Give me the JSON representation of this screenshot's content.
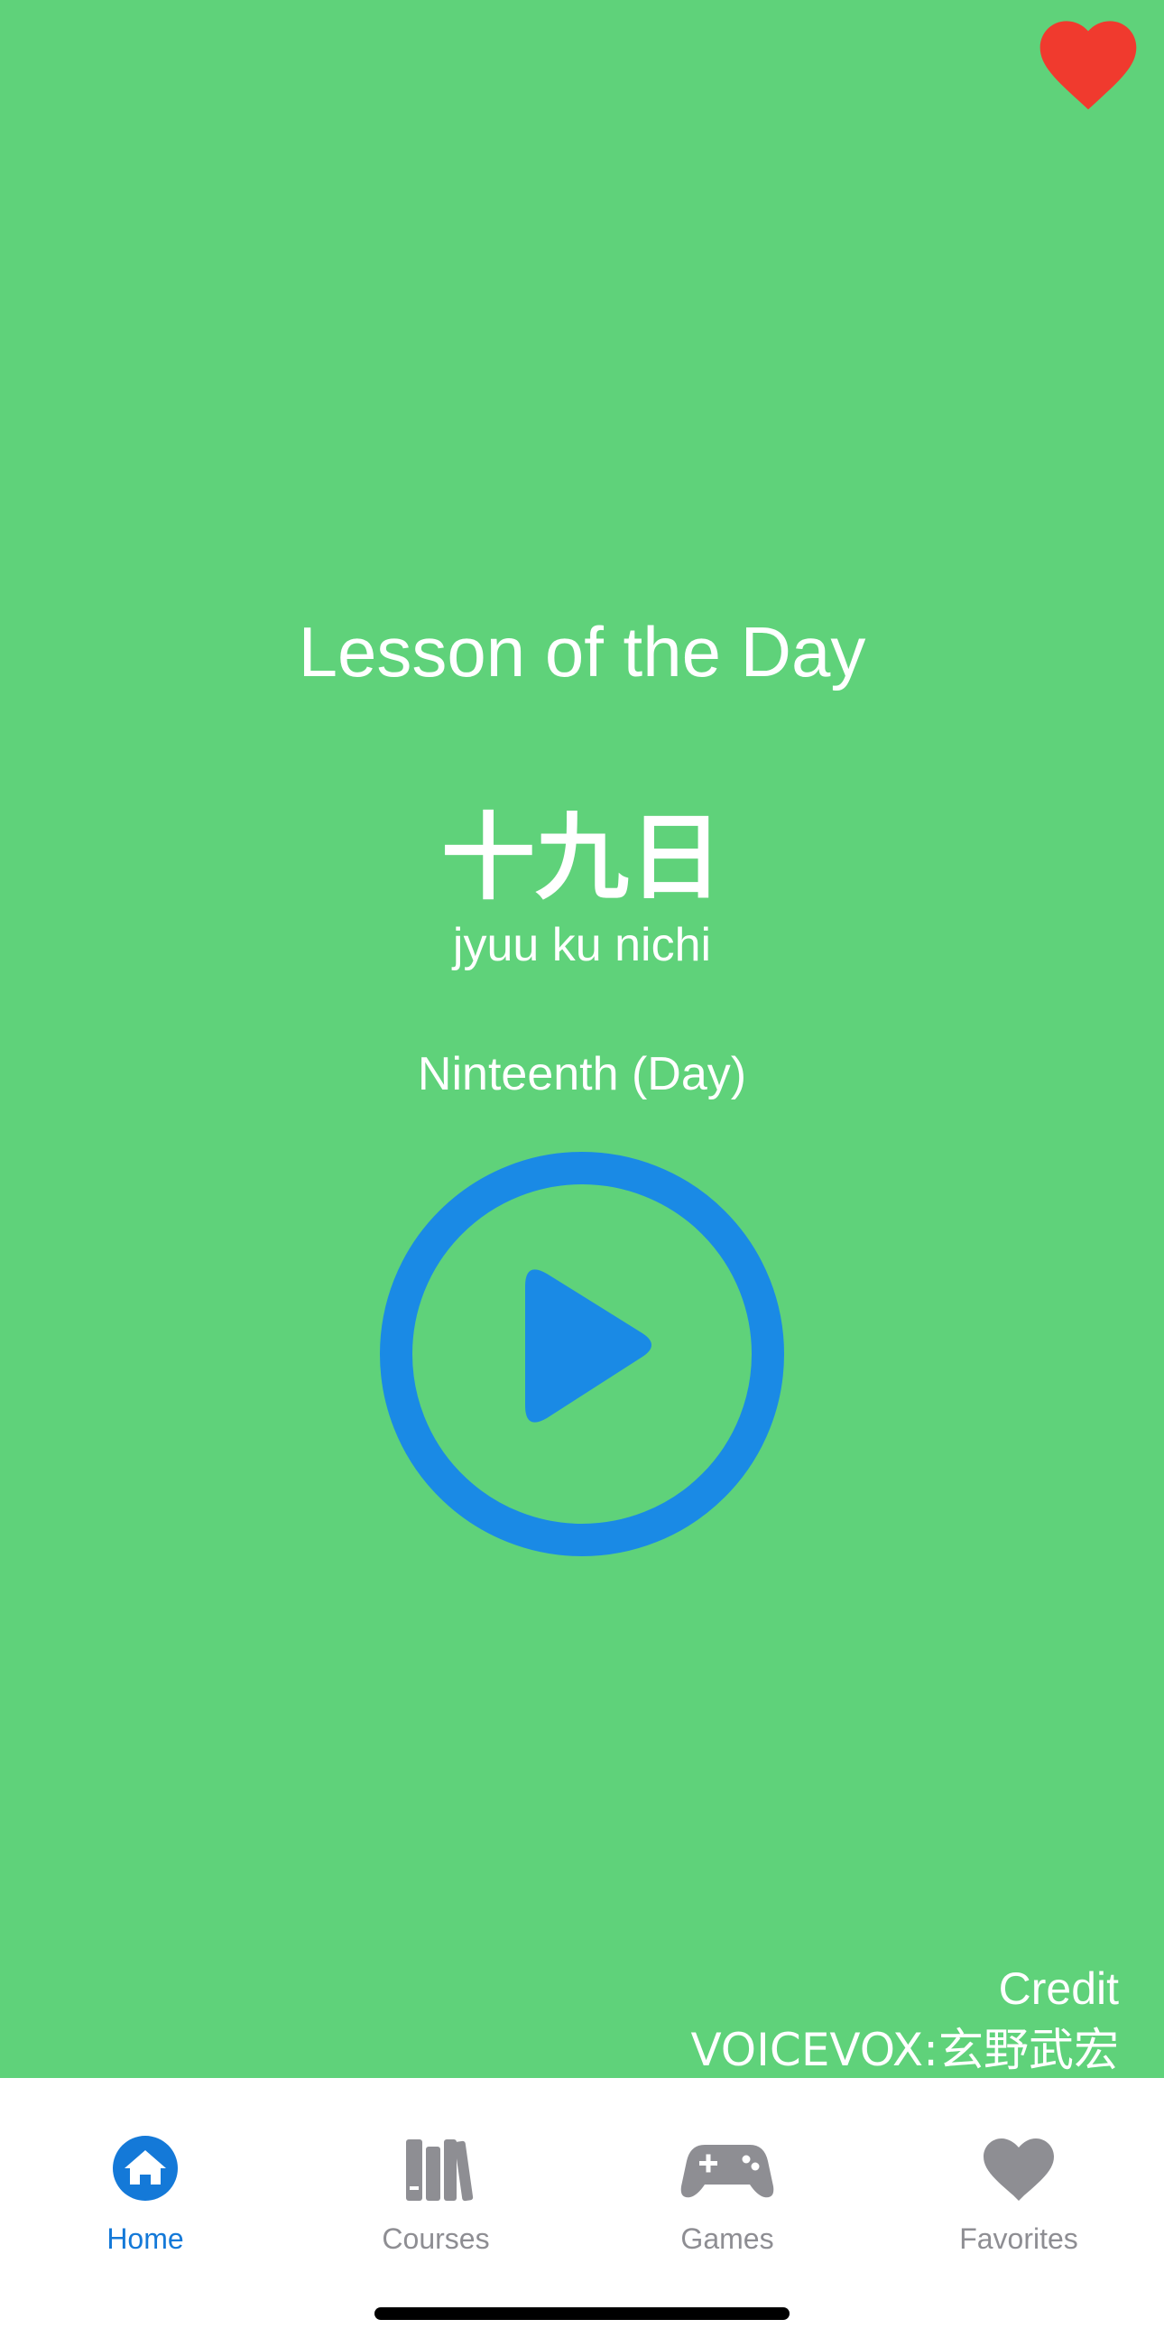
{
  "colors": {
    "background": "#5fd27a",
    "accent_blue": "#1a8ae5",
    "heart_red": "#f03a2e",
    "tab_active": "#1479d8",
    "tab_inactive": "#8e8e93"
  },
  "header": {
    "favorite_icon": "heart-icon"
  },
  "lesson": {
    "title": "Lesson of the Day",
    "japanese": "十九日",
    "romaji": "jyuu ku nichi",
    "meaning": "Ninteenth (Day)",
    "play_icon": "play-circle-icon"
  },
  "credit": {
    "label": "Credit",
    "text": "VOICEVOX:玄野武宏"
  },
  "tabbar": {
    "tabs": [
      {
        "label": "Home",
        "icon": "home-icon",
        "active": true
      },
      {
        "label": "Courses",
        "icon": "books-icon",
        "active": false
      },
      {
        "label": "Games",
        "icon": "gamepad-icon",
        "active": false
      },
      {
        "label": "Favorites",
        "icon": "heart-icon",
        "active": false
      }
    ]
  }
}
